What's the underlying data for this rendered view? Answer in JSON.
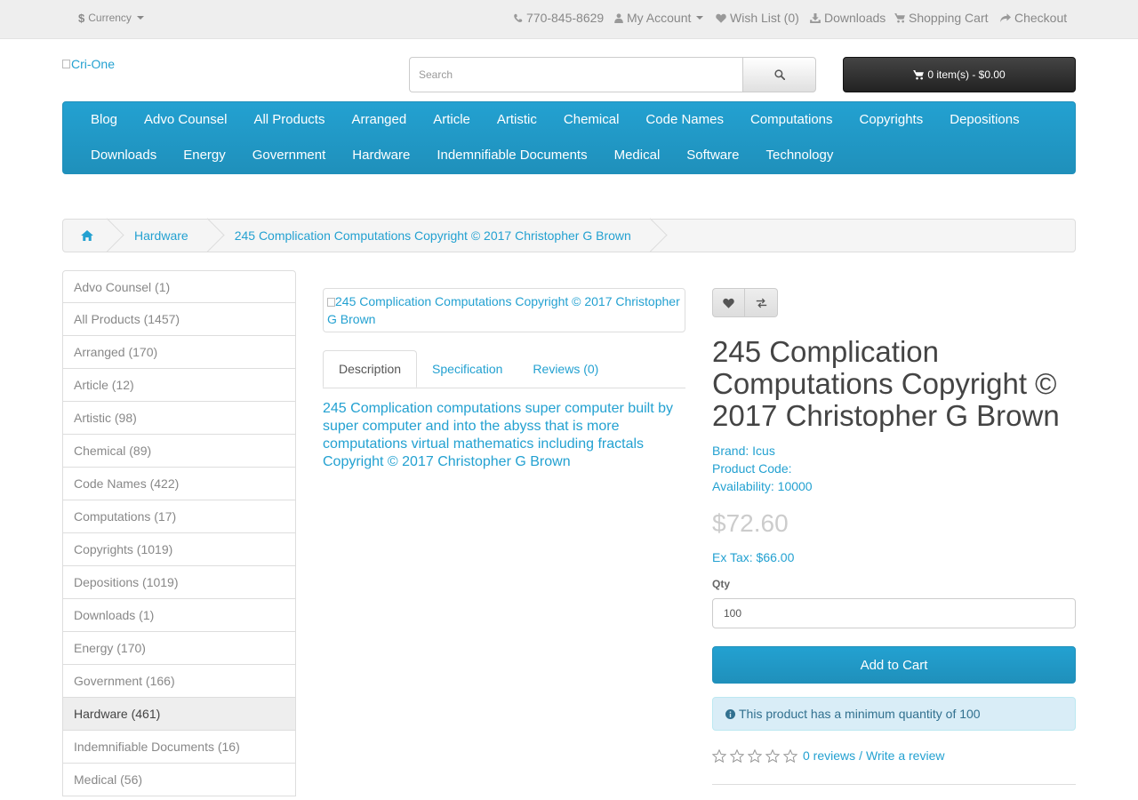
{
  "topbar": {
    "currency": "Currency",
    "phone": "770-845-8629",
    "my_account": "My Account",
    "wish_list": "Wish List (0)",
    "downloads": "Downloads",
    "shopping_cart": "Shopping Cart",
    "checkout": "Checkout"
  },
  "header": {
    "logo_alt": "Cri-One",
    "search_placeholder": "Search",
    "cart_label": "0 item(s) - $0.00"
  },
  "menu": {
    "row1": [
      "Blog",
      "Advo Counsel",
      "All Products",
      "Arranged",
      "Article",
      "Artistic",
      "Chemical",
      "Code Names",
      "Computations",
      "Copyrights",
      "Depositions"
    ],
    "row2": [
      "Downloads",
      "Energy",
      "Government",
      "Hardware",
      "Indemnifiable Documents",
      "Medical",
      "Software",
      "Technology"
    ]
  },
  "breadcrumb": {
    "items": [
      "Hardware",
      "245 Complication Computations Copyright © 2017 Christopher G Brown"
    ]
  },
  "sidebar": {
    "items": [
      {
        "label": "Advo Counsel (1)",
        "active": false
      },
      {
        "label": "All Products (1457)",
        "active": false
      },
      {
        "label": "Arranged (170)",
        "active": false
      },
      {
        "label": "Article (12)",
        "active": false
      },
      {
        "label": "Artistic (98)",
        "active": false
      },
      {
        "label": "Chemical (89)",
        "active": false
      },
      {
        "label": "Code Names (422)",
        "active": false
      },
      {
        "label": "Computations (17)",
        "active": false
      },
      {
        "label": "Copyrights (1019)",
        "active": false
      },
      {
        "label": "Depositions (1019)",
        "active": false
      },
      {
        "label": "Downloads (1)",
        "active": false
      },
      {
        "label": "Energy (170)",
        "active": false
      },
      {
        "label": "Government (166)",
        "active": false
      },
      {
        "label": "Hardware (461)",
        "active": true
      },
      {
        "label": "Indemnifiable Documents (16)",
        "active": false
      },
      {
        "label": "Medical (56)",
        "active": false
      }
    ]
  },
  "product": {
    "image_alt": "245 Complication Computations Copyright © 2017 Christopher G Brown",
    "tabs": [
      "Description",
      "Specification",
      "Reviews (0)"
    ],
    "description": "245 Complication computations  super computer built by super computer and into the abyss that is more computations virtual mathematics including fractals Copyright © 2017 Christopher G Brown",
    "title": "245 Complication Computations Copyright © 2017 Christopher G Brown",
    "brand_label": "Brand:",
    "brand": "Icus",
    "product_code": "Product Code:",
    "availability": "Availability: 10000",
    "price": "$72.60",
    "ex_tax": "Ex Tax: $66.00",
    "qty_label": "Qty",
    "qty_value": "100",
    "add_to_cart": "Add to Cart",
    "min_qty_notice": "This product has a minimum quantity of 100",
    "reviews_link": "0 reviews",
    "rating_sep": "/",
    "write_review": "Write a review"
  },
  "colors": {
    "accent": "#23a1d1",
    "cart_bg": "#222222",
    "alert_bg": "#d9edf7",
    "alert_text": "#31708f"
  }
}
